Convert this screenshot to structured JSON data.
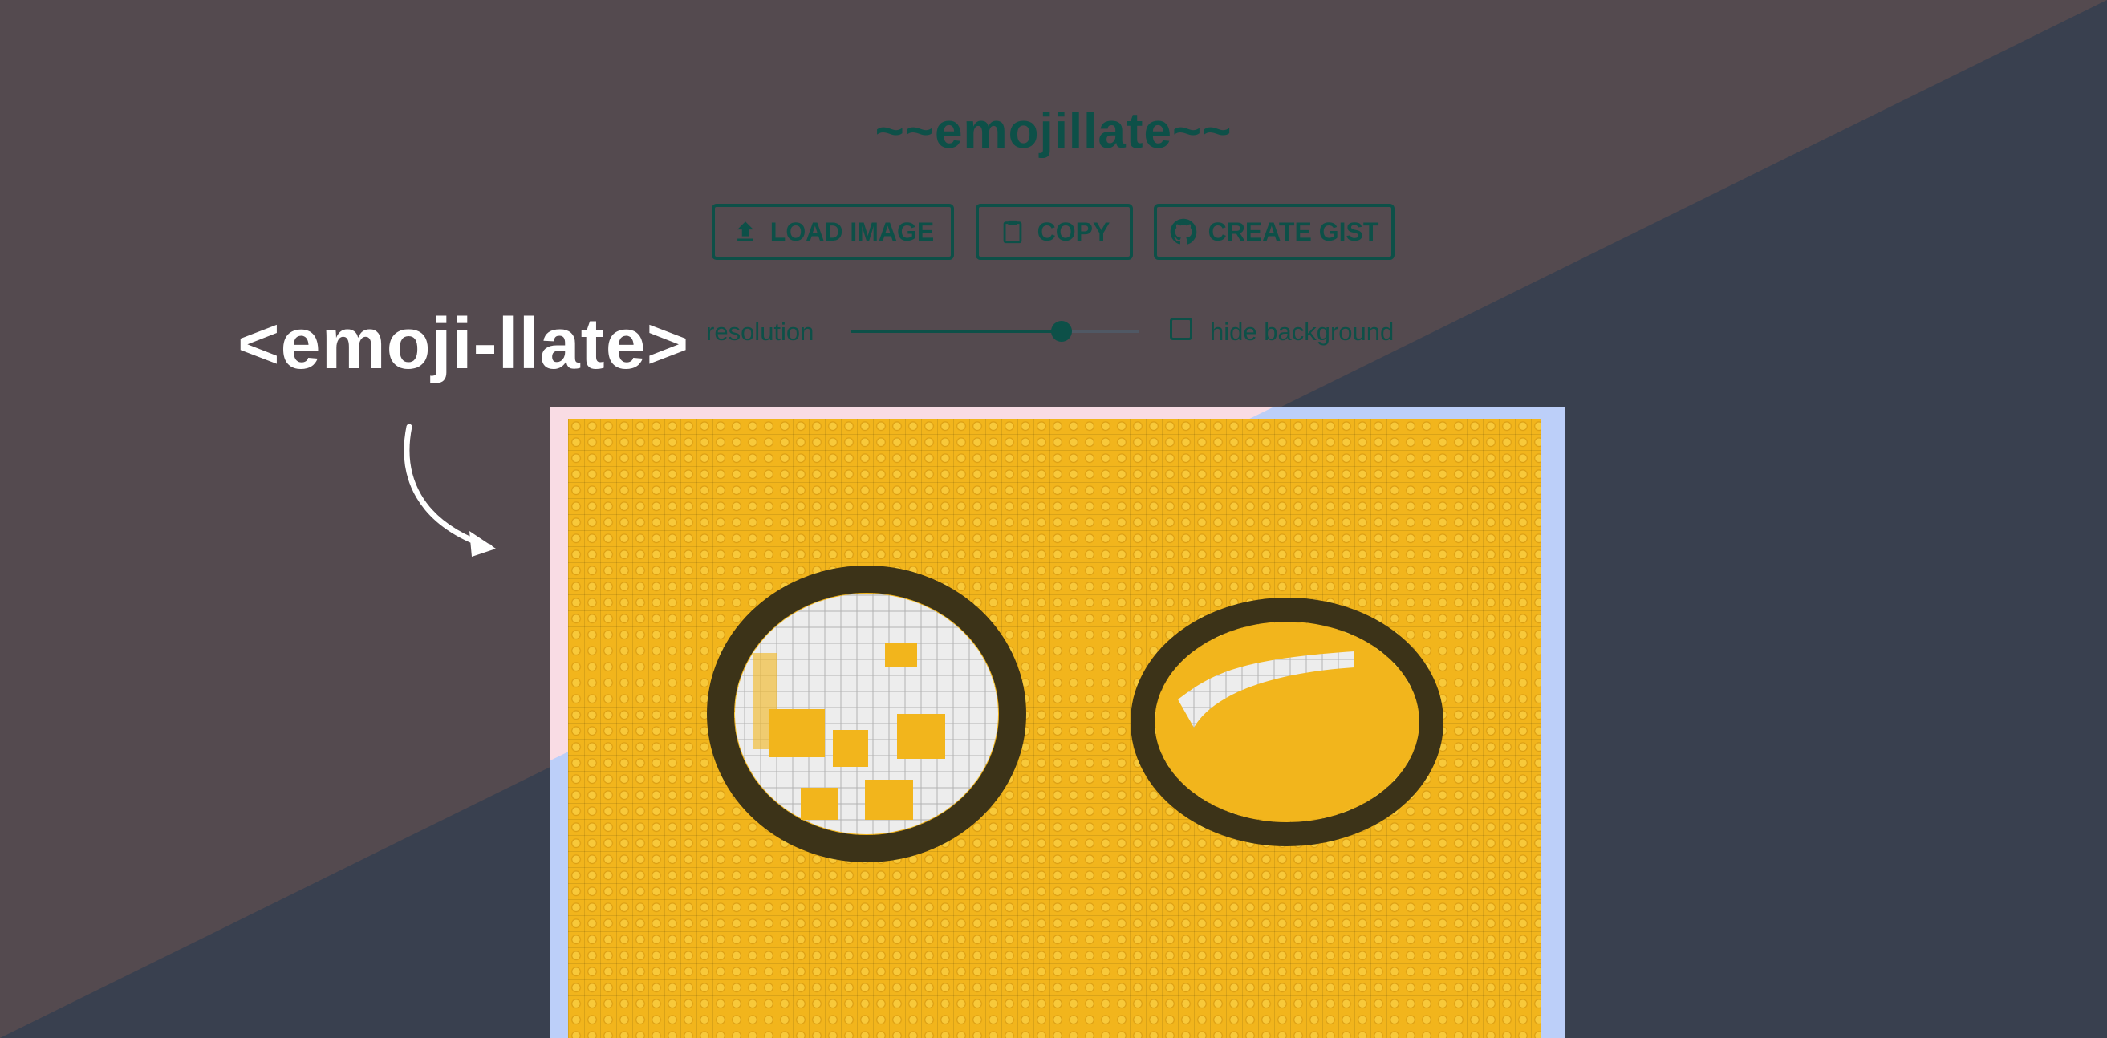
{
  "app": {
    "title": "~~emojillate~~"
  },
  "toolbar": {
    "load_label": "LOAD IMAGE",
    "load_icon": "upload-icon",
    "copy_label": "COPY",
    "copy_icon": "clipboard-icon",
    "gist_label": "CREATE GIST",
    "gist_icon": "github-icon"
  },
  "controls": {
    "resolution_label": "resolution",
    "resolution_fraction": 0.73,
    "hide_background_label": "hide background",
    "hide_background_checked": false
  },
  "overlay": {
    "tag": "<emoji-llate>",
    "arrow_icon": "curved-arrow-icon"
  },
  "colors": {
    "background_top": "#544a4f",
    "background_bottom": "#39404f",
    "accent": "#0d5048",
    "mosaic_yellow": "#f2b51c",
    "frame_pink": "#f9dce4",
    "frame_blue": "#bccff9"
  }
}
